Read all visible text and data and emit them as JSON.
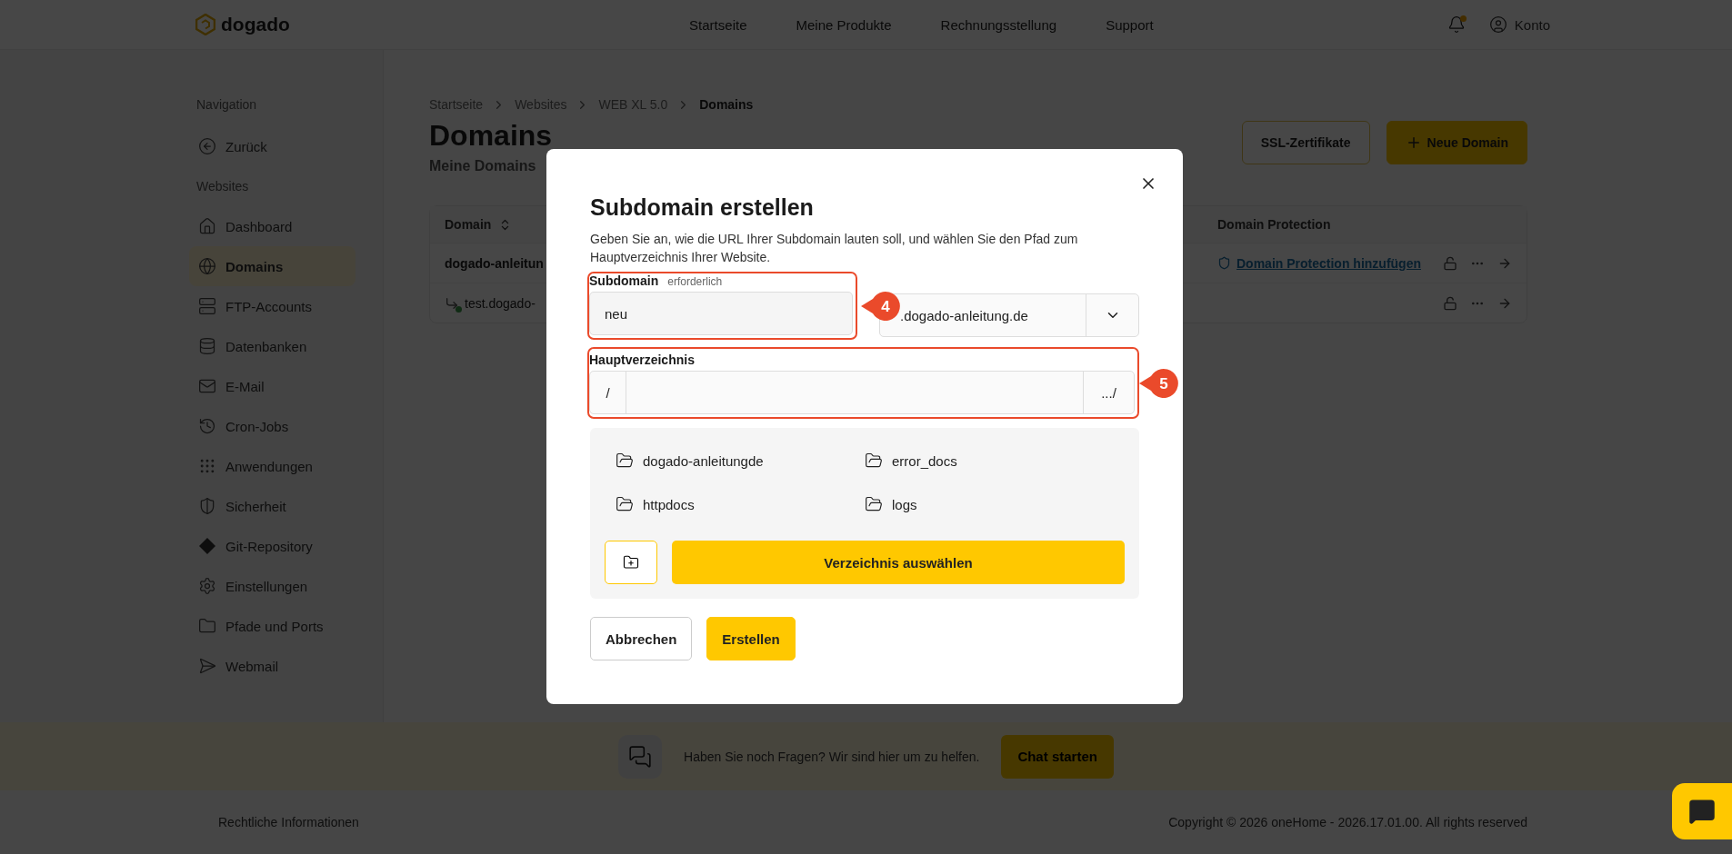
{
  "topbar": {
    "logo": "dogado",
    "nav": [
      {
        "label": "Startseite"
      },
      {
        "label": "Meine Produkte"
      },
      {
        "label": "Rechnungsstellung"
      },
      {
        "label": "Support"
      }
    ],
    "notification": true,
    "account": "Konto"
  },
  "sidebar": {
    "sections": [
      {
        "heading": "Navigation",
        "items": [
          {
            "label": "Zurück",
            "selected": false
          }
        ]
      },
      {
        "heading": "Websites",
        "items": [
          {
            "label": "Dashboard",
            "selected": false
          },
          {
            "label": "Domains",
            "selected": true
          },
          {
            "label": "FTP-Accounts",
            "selected": false
          },
          {
            "label": "Datenbanken",
            "selected": false
          },
          {
            "label": "E-Mail",
            "selected": false
          },
          {
            "label": "Cron-Jobs",
            "selected": false
          },
          {
            "label": "Anwendungen",
            "selected": false
          },
          {
            "label": "Sicherheit",
            "selected": false
          },
          {
            "label": "Git-Repository",
            "selected": false
          },
          {
            "label": "Einstellungen",
            "selected": false
          },
          {
            "label": "Pfade und Ports",
            "selected": false
          },
          {
            "label": "Webmail",
            "selected": false
          }
        ]
      }
    ]
  },
  "breadcrumb": [
    {
      "label": "Startseite",
      "current": false
    },
    {
      "label": "Websites",
      "current": false
    },
    {
      "label": "WEB XL 5.0",
      "current": false
    },
    {
      "label": "Domains",
      "current": true
    }
  ],
  "page": {
    "title": "Domains",
    "subtitle": "Meine Domains"
  },
  "actions": [
    {
      "label": "SSL-Zertifikate",
      "kind": "outline"
    },
    {
      "label": "Neue Domain",
      "kind": "primary"
    }
  ],
  "table": {
    "columns": [
      "Domain",
      "Domain Protection"
    ],
    "rows": [
      {
        "kind": "main",
        "domain": "dogado-anleitun",
        "protection": "Domain Protection hinzufügen"
      },
      {
        "kind": "sub",
        "domain": "test.dogado-"
      }
    ]
  },
  "dialog": {
    "title": "Subdomain erstellen",
    "description": "Geben Sie an, wie die URL Ihrer Subdomain lauten soll, und wählen Sie den Pfad zum Hauptverzeichnis Ihrer Website.",
    "subdomain": {
      "label": "Subdomain",
      "hint": "erforderlich",
      "value": "neu",
      "callout": "4"
    },
    "domain_select": {
      "value": ".dogado-anleitung.de"
    },
    "directory": {
      "label": "Hauptverzeichnis",
      "prefix": "/",
      "suffix": ".../",
      "callout": "5"
    },
    "folders": [
      {
        "name": "dogado-anleitungde"
      },
      {
        "name": "error_docs"
      },
      {
        "name": "httpdocs"
      },
      {
        "name": "logs"
      }
    ],
    "select_button": "Verzeichnis auswählen",
    "buttons": [
      {
        "label": "Abbrechen",
        "kind": "secondary"
      },
      {
        "label": "Erstellen",
        "kind": "primary"
      }
    ]
  },
  "chat_banner": {
    "text": "Haben Sie noch Fragen? Wir sind hier um zu helfen.",
    "button": "Chat starten"
  },
  "footer": {
    "legal": "Rechtliche Informationen",
    "copyright": "Copyright © 2026 oneHome - 2026.17.01.00. All rights reserved"
  }
}
